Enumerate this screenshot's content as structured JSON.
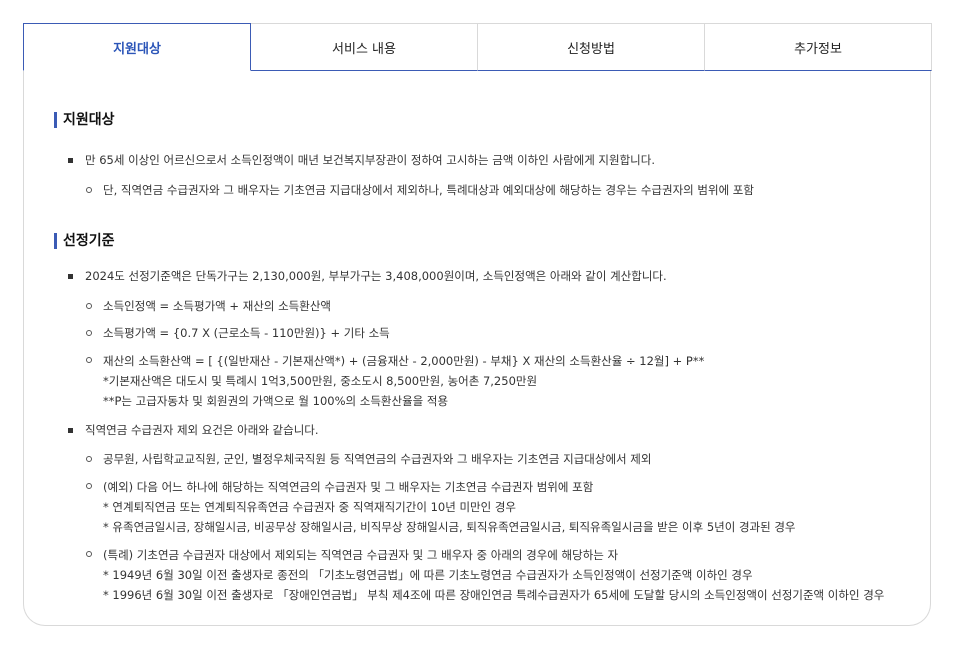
{
  "tabs": [
    {
      "label": "지원대상"
    },
    {
      "label": "서비스 내용"
    },
    {
      "label": "신청방법"
    },
    {
      "label": "추가정보"
    }
  ],
  "section1": {
    "title": "지원대상",
    "bullet1": "만 65세 이상인 어르신으로서 소득인정액이 매년 보건복지부장관이 정하여 고시하는 금액 이하인 사람에게 지원합니다.",
    "sub1": "단, 직역연금 수급권자와 그 배우자는 기초연금 지급대상에서 제외하나, 특례대상과 예외대상에 해당하는 경우는 수급권자의 범위에 포함"
  },
  "section2": {
    "title": "선정기준",
    "bullet1": "2024도 선정기준액은 단독가구는 2,130,000원, 부부가구는 3,408,000원이며, 소득인정액은 아래와 같이 계산합니다.",
    "sub1": "소득인정액 = 소득평가액 + 재산의 소득환산액",
    "sub2": "소득평가액 = {0.7 X (근로소득 - 110만원)} + 기타 소득",
    "sub3_line1": "재산의 소득환산액 = [ {(일반재산 - 기본재산액*) + (금융재산 - 2,000만원) - 부채} X 재산의 소득환산율 ÷ 12월] + P**",
    "sub3_line2": "*기본재산액은 대도시 및 특례시 1억3,500만원, 중소도시 8,500만원, 농어촌 7,250만원",
    "sub3_line3": "**P는 고급자동차 및 회원권의 가액으로 월 100%의 소득환산율을 적용",
    "bullet2": "직역연금 수급권자 제외 요건은 아래와 같습니다.",
    "sub4": "공무원, 사립학교교직원, 군인, 별정우체국직원 등 직역연금의 수급권자와 그 배우자는 기초연금 지급대상에서 제외",
    "sub5_line1": "(예외) 다음 어느 하나에 해당하는 직역연금의 수급권자 및 그 배우자는 기초연금 수급권자 범위에 포함",
    "sub5_line2": "* 연계퇴직연금 또는 연계퇴직유족연금 수급권자 중 직역재직기간이 10년 미만인 경우",
    "sub5_line3": "* 유족연금일시금, 장해일시금, 비공무상 장해일시금, 비직무상 장해일시금, 퇴직유족연금일시금, 퇴직유족일시금을 받은 이후 5년이 경과된 경우",
    "sub6_line1": "(특례) 기초연금 수급권자 대상에서 제외되는 직역연금 수급권자 및 그 배우자 중 아래의 경우에 해당하는 자",
    "sub6_line2": "* 1949년 6월 30일 이전 출생자로 종전의 「기초노령연금법」에 따른 기초노령연금 수급권자가 소득인정액이 선정기준액 이하인 경우",
    "sub6_line3": "* 1996년 6월 30일 이전 출생자로 「장애인연금법」 부칙 제4조에 따른 장애인연금 특례수급권자가 65세에 도달할 당시의 소득인정액이 선정기준액 이하인 경우"
  }
}
